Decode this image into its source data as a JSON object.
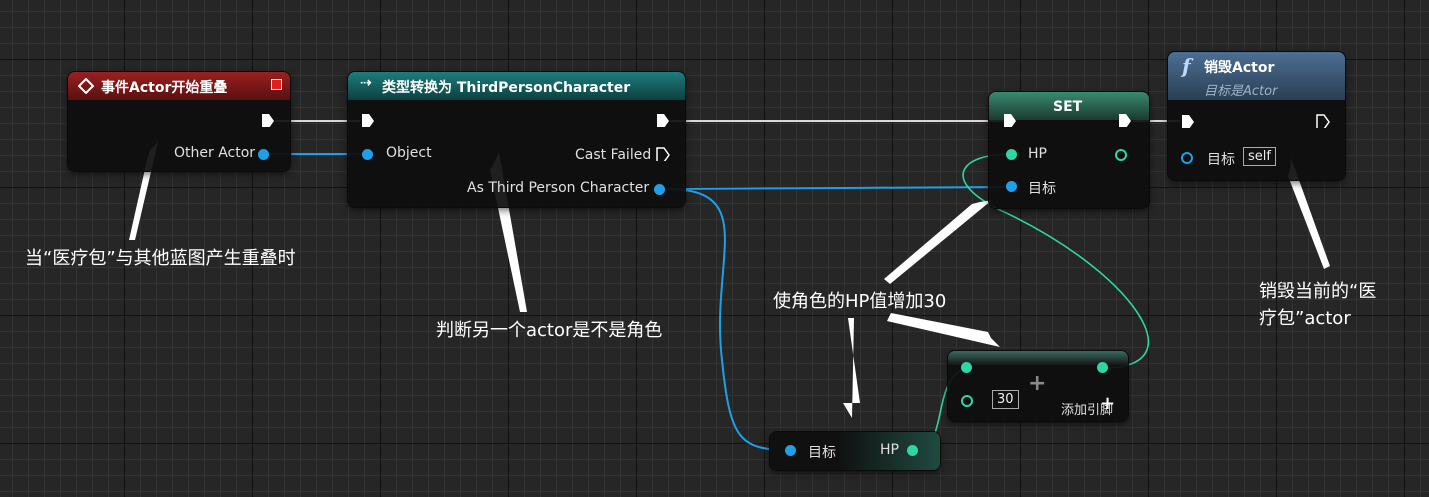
{
  "nodes": {
    "overlap_event": {
      "title": "事件Actor开始重叠",
      "other_actor_label": "Other Actor"
    },
    "cast": {
      "title": "类型转换为 ThirdPersonCharacter",
      "object_label": "Object",
      "cast_failed_label": "Cast Failed",
      "as_label": "As Third Person Character"
    },
    "set": {
      "title": "SET",
      "hp_label": "HP",
      "target_label": "目标"
    },
    "destroy": {
      "title": "销毁Actor",
      "subtitle": "目标是Actor",
      "target_label": "目标",
      "self_value": "self"
    },
    "get_hp": {
      "target_label": "目标",
      "hp_label": "HP"
    },
    "add": {
      "value": "30",
      "add_pin_label": "添加引脚",
      "plus": "+"
    }
  },
  "annotations": {
    "overlap": "当“医疗包”与其他蓝图产生重叠时",
    "cast": "判断另一个actor是不是角色",
    "hp": "使角色的HP值增加30",
    "destroy_line1": "销毁当前的“医",
    "destroy_line2": "疗包”actor"
  },
  "colors": {
    "event_header": "#8a1a1a",
    "cast_header": "#1a6b6b",
    "set_header": "#2c6f5a",
    "destroy_header": "#3a5a7a",
    "object_wire": "#1ea0e8",
    "float_wire": "#2fd6a5",
    "exec_wire": "#e0e0e0"
  },
  "icons": {
    "event": "diamond-icon",
    "cast": "cast-arrows-icon",
    "function": "function-f-icon"
  }
}
